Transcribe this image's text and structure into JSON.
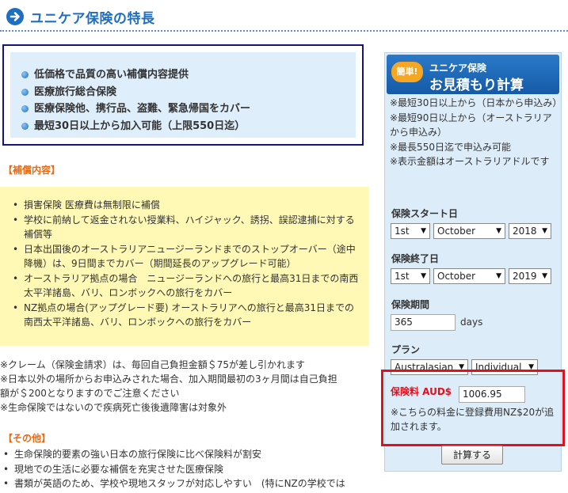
{
  "header": {
    "title": "ユニケア保険の特長"
  },
  "features": [
    "低価格で品質の高い補償内容提供",
    "医療旅行総合保険",
    "医療保険他、携行品、盗難、緊急帰国をカバー",
    "最短30日以上から加入可能（上限550日迄）"
  ],
  "coverage": {
    "heading": "【補償内容】",
    "items": [
      "損害保険 医療費は無制限に補償",
      "学校に前納して返金されない授業料、ハイジャック、誘拐、誤認逮捕に対する補償等",
      "日本出国後のオーストラリアニュージーランドまでのストップオーバー（途中降機）は、9日間までカバー（期間延長のアップグレード可能）",
      "オーストラリア拠点の場合　ニュージーランドへの旅行と最高31日までの南西太平洋諸島、バリ、ロンボックへの旅行をカバー",
      "NZ拠点の場合(アップグレード要) オーストラリアへの旅行と最高31日までの南西太平洋諸島、バリ、ロンボックへの旅行をカバー"
    ]
  },
  "notes": [
    "※クレーム（保険金請求）は、毎回自己負担金額＄75が差し引かれます",
    "※日本以外の場所からお申込みされた場合、加入期間最初の3ヶ月間は自己負担",
    "額が＄200となりますのでご注意ください",
    "※生命保険ではないので疾病死亡後後遺障害は対象外"
  ],
  "other": {
    "heading": "【その他】",
    "items": [
      "生命保険的要素の強い日本の旅行保険に比べ保険料が割安",
      "現地での生活に必要な補償を充実させた医療保険",
      "書類が英語のため、学校や現地スタッフが対応しやすい　(特にNZの学校では"
    ]
  },
  "quote": {
    "badge": "簡単!",
    "title_small": "ユニケア保険",
    "title_large": "お見積もり計算",
    "notes": [
      "※最短30日以上から（日本から申込み）",
      "※最短90日以上から（オーストラリアから申込み）",
      "※最長550日迄で申込み可能",
      "※表示金額はオーストラリアドルです"
    ],
    "start_label": "保険スタート日",
    "start_day": "1st",
    "start_month": "October",
    "start_year": "2018",
    "end_label": "保険終了日",
    "end_day": "1st",
    "end_month": "October",
    "end_year": "2019",
    "period_label": "保険期間",
    "period_value": "365",
    "period_unit": "days",
    "plan_label": "プラン",
    "plan_region": "Australasian",
    "plan_type": "Individual",
    "premium_label": "保険料 AUD$",
    "premium_value": "1006.95",
    "premium_note": "※こちらの料金に登録費用NZ$20が追加されます。",
    "calc_button": "計算する"
  },
  "colors": {
    "brand_blue": "#1f6fc0",
    "accent_orange": "#e86a12",
    "highlight_red": "#e0111d",
    "yellow_box": "#fff9b5",
    "panel_bg": "#dcecf9"
  }
}
